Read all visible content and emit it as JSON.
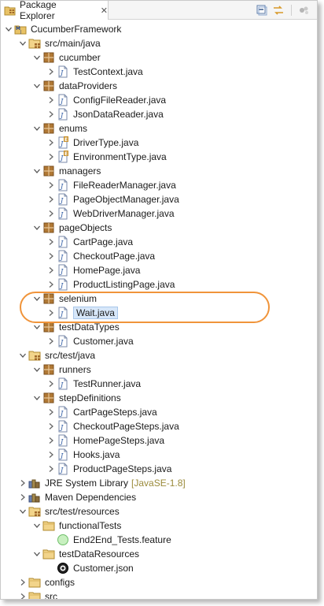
{
  "tab": {
    "title": "Package Explorer",
    "close": "✕"
  },
  "toolbar": {
    "icons": [
      "collapse-all-icon",
      "link-with-editor-icon",
      "view-menu-icon"
    ]
  },
  "tree": [
    {
      "label": "CucumberFramework",
      "icon": "project-icon",
      "depth": 0,
      "expanded": true
    },
    {
      "label": "src/main/java",
      "icon": "source-folder-icon",
      "depth": 1,
      "expanded": true
    },
    {
      "label": "cucumber",
      "icon": "package-icon",
      "depth": 2,
      "expanded": true
    },
    {
      "label": "TestContext.java",
      "icon": "java-file-icon",
      "depth": 3,
      "expanded": false
    },
    {
      "label": "dataProviders",
      "icon": "package-icon",
      "depth": 2,
      "expanded": true
    },
    {
      "label": "ConfigFileReader.java",
      "icon": "java-file-icon",
      "depth": 3,
      "expanded": false
    },
    {
      "label": "JsonDataReader.java",
      "icon": "java-file-icon",
      "depth": 3,
      "expanded": false
    },
    {
      "label": "enums",
      "icon": "package-icon",
      "depth": 2,
      "expanded": true
    },
    {
      "label": "DriverType.java",
      "icon": "java-enum-file-icon",
      "depth": 3,
      "expanded": false
    },
    {
      "label": "EnvironmentType.java",
      "icon": "java-enum-file-icon",
      "depth": 3,
      "expanded": false
    },
    {
      "label": "managers",
      "icon": "package-icon",
      "depth": 2,
      "expanded": true
    },
    {
      "label": "FileReaderManager.java",
      "icon": "java-file-icon",
      "depth": 3,
      "expanded": false
    },
    {
      "label": "PageObjectManager.java",
      "icon": "java-file-icon",
      "depth": 3,
      "expanded": false
    },
    {
      "label": "WebDriverManager.java",
      "icon": "java-file-icon",
      "depth": 3,
      "expanded": false
    },
    {
      "label": "pageObjects",
      "icon": "package-icon",
      "depth": 2,
      "expanded": true
    },
    {
      "label": "CartPage.java",
      "icon": "java-file-icon",
      "depth": 3,
      "expanded": false
    },
    {
      "label": "CheckoutPage.java",
      "icon": "java-file-icon",
      "depth": 3,
      "expanded": false
    },
    {
      "label": "HomePage.java",
      "icon": "java-file-icon",
      "depth": 3,
      "expanded": false
    },
    {
      "label": "ProductListingPage.java",
      "icon": "java-file-icon",
      "depth": 3,
      "expanded": false
    },
    {
      "label": "selenium",
      "icon": "package-icon",
      "depth": 2,
      "expanded": true
    },
    {
      "label": "Wait.java",
      "icon": "java-file-icon",
      "depth": 3,
      "expanded": false,
      "selected": true
    },
    {
      "label": "testDataTypes",
      "icon": "package-icon",
      "depth": 2,
      "expanded": true
    },
    {
      "label": "Customer.java",
      "icon": "java-file-icon",
      "depth": 3,
      "expanded": false
    },
    {
      "label": "src/test/java",
      "icon": "source-folder-icon",
      "depth": 1,
      "expanded": true
    },
    {
      "label": "runners",
      "icon": "package-icon",
      "depth": 2,
      "expanded": true
    },
    {
      "label": "TestRunner.java",
      "icon": "java-file-icon",
      "depth": 3,
      "expanded": false
    },
    {
      "label": "stepDefinitions",
      "icon": "package-icon",
      "depth": 2,
      "expanded": true
    },
    {
      "label": "CartPageSteps.java",
      "icon": "java-file-icon",
      "depth": 3,
      "expanded": false
    },
    {
      "label": "CheckoutPageSteps.java",
      "icon": "java-file-icon",
      "depth": 3,
      "expanded": false
    },
    {
      "label": "HomePageSteps.java",
      "icon": "java-file-icon",
      "depth": 3,
      "expanded": false
    },
    {
      "label": "Hooks.java",
      "icon": "java-file-icon",
      "depth": 3,
      "expanded": false
    },
    {
      "label": "ProductPageSteps.java",
      "icon": "java-file-icon",
      "depth": 3,
      "expanded": false
    },
    {
      "label": "JRE System Library",
      "icon": "library-icon",
      "depth": 1,
      "expanded": false,
      "decoration": "[JavaSE-1.8]"
    },
    {
      "label": "Maven Dependencies",
      "icon": "library-icon",
      "depth": 1,
      "expanded": false
    },
    {
      "label": "src/test/resources",
      "icon": "source-folder-icon",
      "depth": 1,
      "expanded": true
    },
    {
      "label": "functionalTests",
      "icon": "folder-icon",
      "depth": 2,
      "expanded": true
    },
    {
      "label": "End2End_Tests.feature",
      "icon": "feature-file-icon",
      "depth": 3,
      "expanded": null
    },
    {
      "label": "testDataResources",
      "icon": "folder-icon",
      "depth": 2,
      "expanded": true
    },
    {
      "label": "Customer.json",
      "icon": "json-file-icon",
      "depth": 3,
      "expanded": null
    },
    {
      "label": "configs",
      "icon": "folder-icon",
      "depth": 1,
      "expanded": false
    },
    {
      "label": "src",
      "icon": "folder-icon",
      "depth": 1,
      "expanded": false
    }
  ],
  "colors": {
    "selection": "#d7e7f9",
    "highlight_ring": "#f0943a",
    "package": "#a0682a",
    "folder": "#e8c266"
  }
}
